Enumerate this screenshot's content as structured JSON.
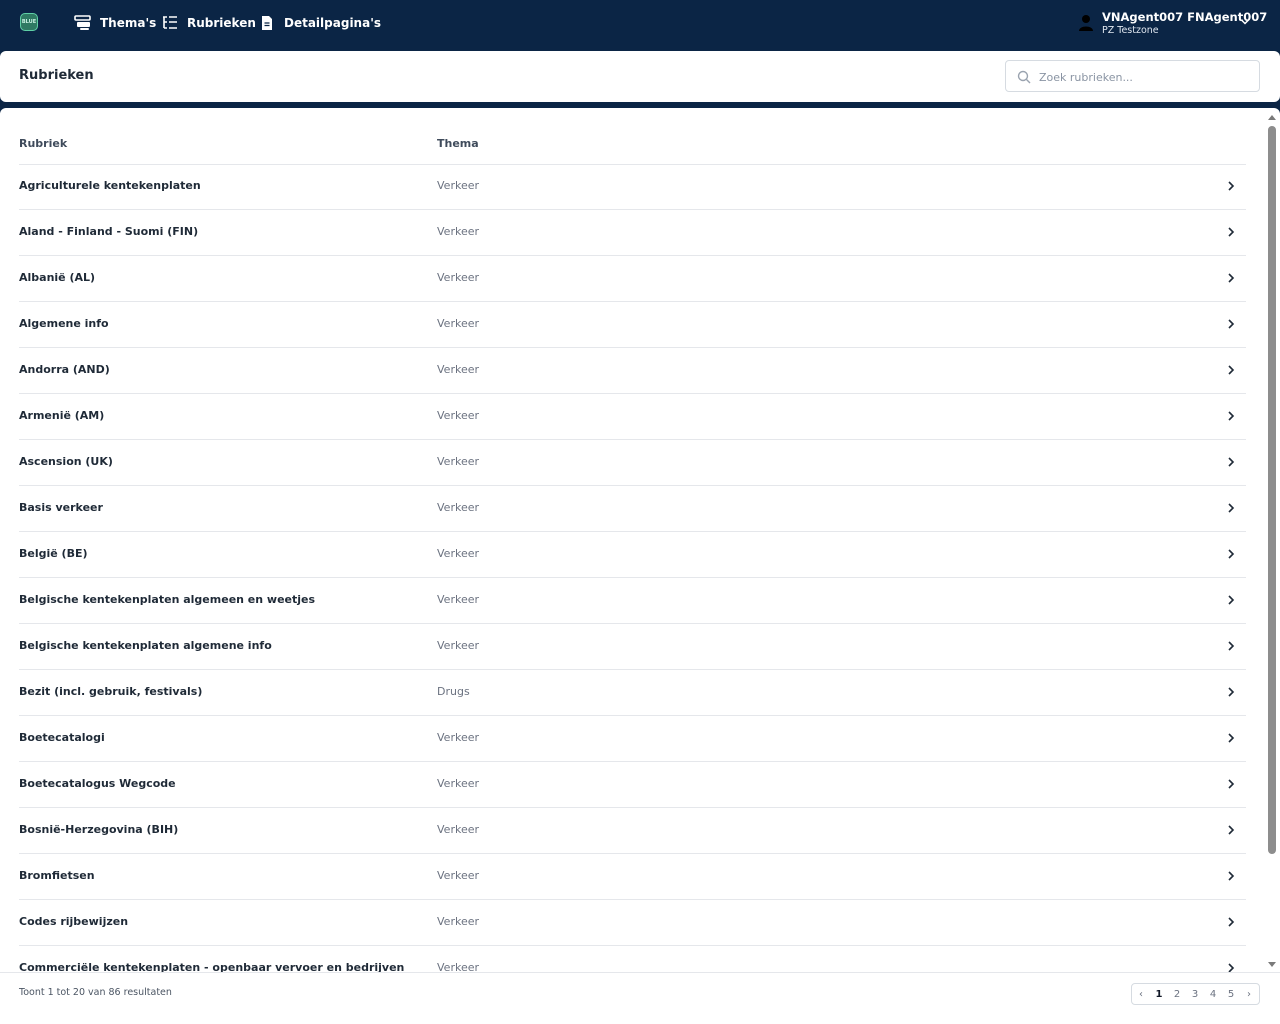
{
  "app": {
    "logo_text": "BLUE",
    "nav": [
      {
        "label": "Thema's",
        "icon": "themes-icon"
      },
      {
        "label": "Rubrieken",
        "icon": "tree-list-icon"
      },
      {
        "label": "Detailpagina's",
        "icon": "document-icon"
      }
    ],
    "user": {
      "name": "VNAgent007 FNAgent007",
      "org": "PZ Testzone"
    }
  },
  "header": {
    "title": "Rubrieken",
    "search": {
      "placeholder": "Zoek rubrieken...",
      "value": ""
    }
  },
  "table": {
    "columns": [
      "Rubriek",
      "Thema"
    ],
    "rows": [
      {
        "rubriek": "Agriculturele kentekenplaten",
        "thema": "Verkeer"
      },
      {
        "rubriek": "Aland - Finland - Suomi (FIN)",
        "thema": "Verkeer"
      },
      {
        "rubriek": "Albanië (AL)",
        "thema": "Verkeer"
      },
      {
        "rubriek": "Algemene info",
        "thema": "Verkeer"
      },
      {
        "rubriek": "Andorra (AND)",
        "thema": "Verkeer"
      },
      {
        "rubriek": "Armenië (AM)",
        "thema": "Verkeer"
      },
      {
        "rubriek": "Ascension (UK)",
        "thema": "Verkeer"
      },
      {
        "rubriek": "Basis verkeer",
        "thema": "Verkeer"
      },
      {
        "rubriek": "België (BE)",
        "thema": "Verkeer"
      },
      {
        "rubriek": "Belgische kentekenplaten algemeen en weetjes",
        "thema": "Verkeer"
      },
      {
        "rubriek": "Belgische kentekenplaten algemene info",
        "thema": "Verkeer"
      },
      {
        "rubriek": "Bezit (incl. gebruik, festivals)",
        "thema": "Drugs"
      },
      {
        "rubriek": "Boetecatalogi",
        "thema": "Verkeer"
      },
      {
        "rubriek": "Boetecatalogus Wegcode",
        "thema": "Verkeer"
      },
      {
        "rubriek": "Bosnië-Herzegovina (BIH)",
        "thema": "Verkeer"
      },
      {
        "rubriek": "Bromfietsen",
        "thema": "Verkeer"
      },
      {
        "rubriek": "Codes rijbewijzen",
        "thema": "Verkeer"
      },
      {
        "rubriek": "Commerciële kentekenplaten - openbaar vervoer en bedrijven",
        "thema": "Verkeer"
      }
    ]
  },
  "footer": {
    "results_text": "Toont 1 tot 20 van 86 resultaten",
    "pagination": {
      "prev": "‹",
      "next": "›",
      "pages": [
        "1",
        "2",
        "3",
        "4",
        "5"
      ],
      "current": "1"
    }
  },
  "colors": {
    "navy": "#0b2545",
    "text": "#1f2a37",
    "muted": "#6b7280",
    "border": "#e5e7eb"
  }
}
